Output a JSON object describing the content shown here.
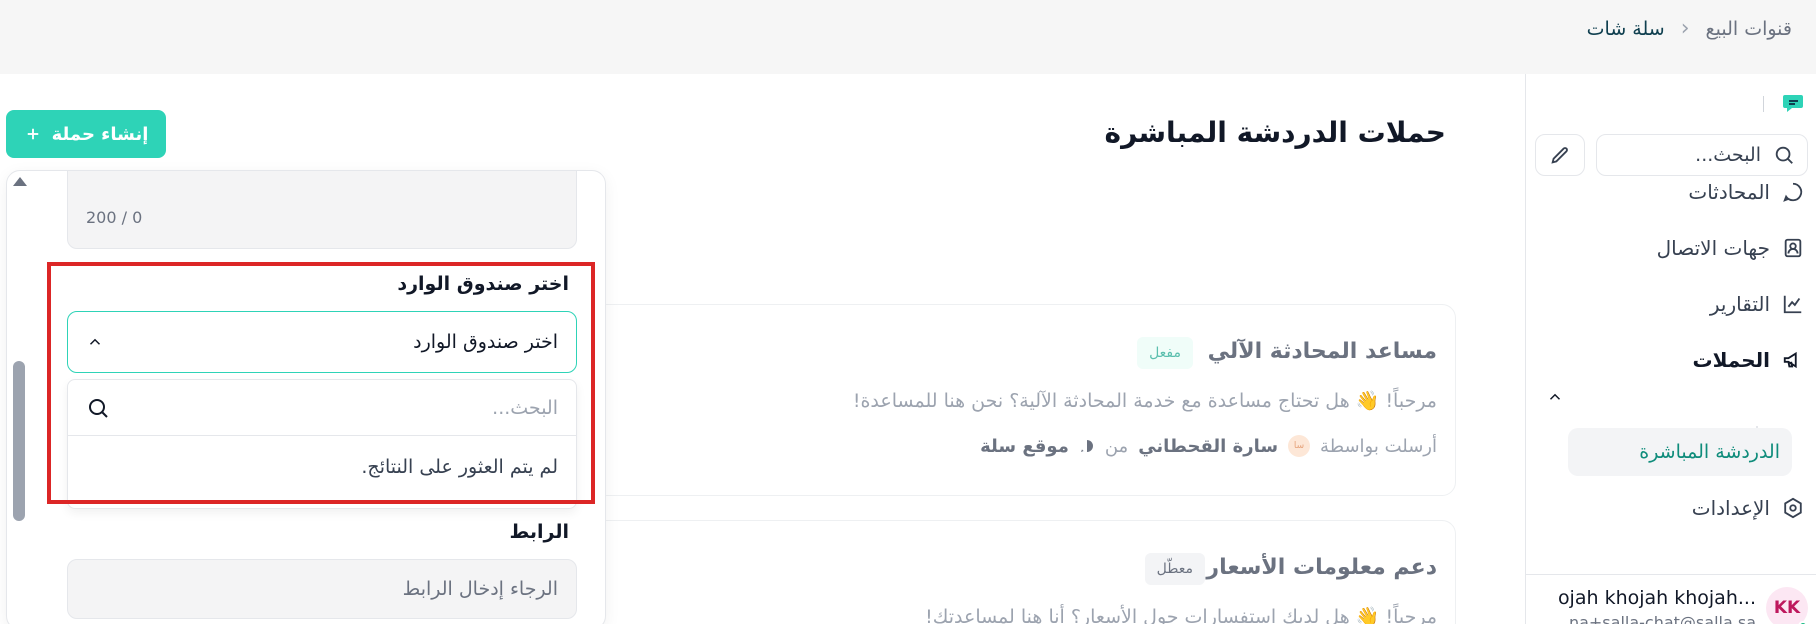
{
  "breadcrumb": {
    "root": "قنوات البيع",
    "current": "سلة شات"
  },
  "sidebar": {
    "search_placeholder": "البحث...",
    "items": [
      {
        "label": "المحادثات",
        "icon": "chat-bubble-icon"
      },
      {
        "label": "جهات الاتصال",
        "icon": "contact-card-icon"
      },
      {
        "label": "التقارير",
        "icon": "chart-line-icon"
      },
      {
        "label": "الحملات",
        "icon": "megaphone-icon"
      },
      {
        "label": "الإعدادات",
        "icon": "gear-icon"
      }
    ],
    "sub_item": "الدردشة المباشرة",
    "user": {
      "initials": "KK",
      "name": "ojah khojah khojah...",
      "email": "na+salla-chat@salla.sa"
    }
  },
  "main": {
    "title": "حملات الدردشة المباشرة",
    "create_button": "إنشاء حملة",
    "cards": [
      {
        "title": "مساعد المحادثة الآلي",
        "status": "مفعل",
        "message": "مرحباً! 👋 هل تحتاج مساعدة مع خدمة المحادثة الآلية؟ نحن هنا للمساعدة!",
        "sent_by_label": "أرسلت بواسطة",
        "sender_initials": "سا",
        "sender": "سارة القحطاني",
        "from_label": "من",
        "source": "موقع سلة"
      },
      {
        "title": "دعم معلومات الأسعار",
        "status": "معطّل",
        "message": "مرحباً! 👋 هل لديك استفسارات حول الأسعار؟ أنا هنا لمساعدتك!"
      }
    ]
  },
  "panel": {
    "counter": "200 / 0",
    "inbox_label": "اختر صندوق الوارد",
    "inbox_value": "اختر صندوق الوارد",
    "dropdown_search_placeholder": "البحث...",
    "dropdown_empty": "لم يتم العثور على النتائج.",
    "link_label": "الرابط",
    "link_placeholder": "الرجاء إدخال الرابط"
  },
  "colors": {
    "accent": "#2ed3b7",
    "highlight": "#dc2626",
    "active_text": "#0f8c7b"
  }
}
